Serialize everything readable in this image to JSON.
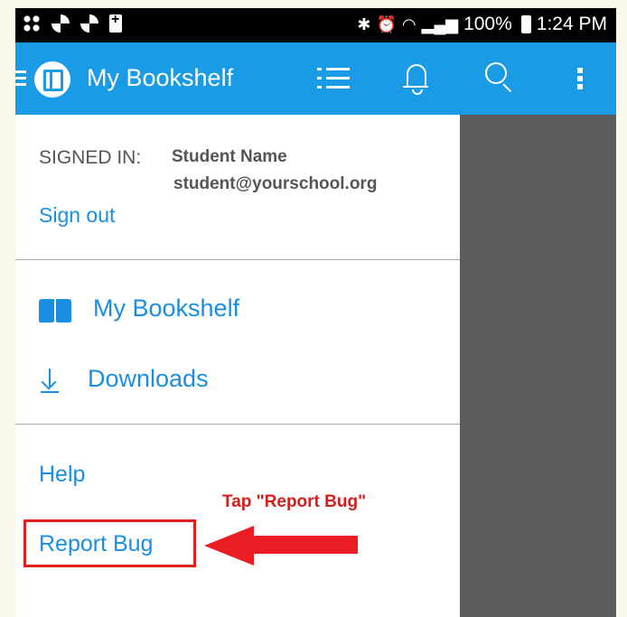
{
  "status_bar": {
    "battery_percent": "100%",
    "time": "1:24 PM"
  },
  "app_bar": {
    "title": "My Bookshelf"
  },
  "drawer": {
    "signed_in_label": "SIGNED IN:",
    "student_name": "Student Name",
    "student_email": "student@yourschool.org",
    "sign_out": "Sign out",
    "nav": {
      "bookshelf": "My Bookshelf",
      "downloads": "Downloads"
    },
    "help": "Help",
    "report_bug": "Report Bug"
  },
  "annotation": {
    "text": "Tap \"Report Bug\"",
    "color": "#e02020"
  },
  "colors": {
    "app_bar": "#1a9be6",
    "link": "#1a8ee0",
    "overlay": "#5c5c5c"
  }
}
